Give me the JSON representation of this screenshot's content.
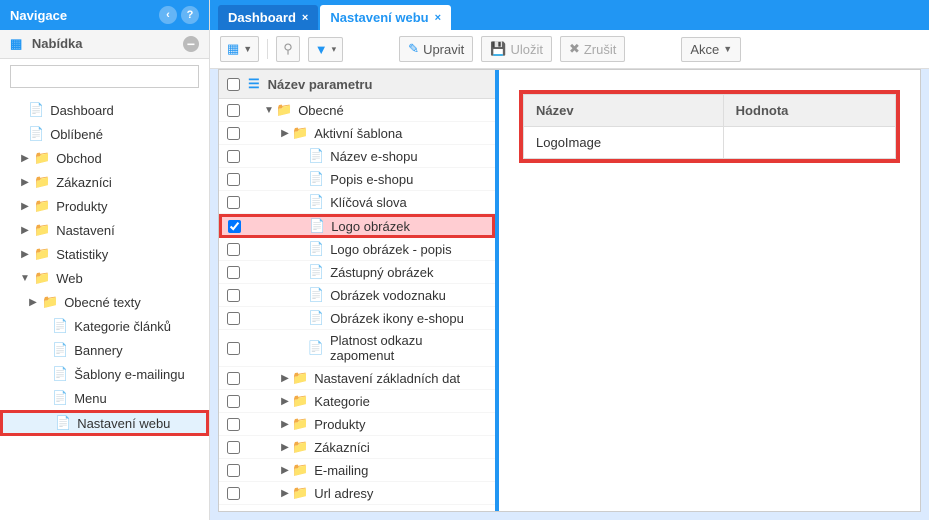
{
  "sidebar": {
    "title": "Navigace",
    "menu_title": "Nabídka",
    "search_placeholder": "",
    "items": [
      {
        "label": "Dashboard",
        "type": "file",
        "level": 1
      },
      {
        "label": "Oblíbené",
        "type": "file",
        "level": 1
      },
      {
        "label": "Obchod",
        "type": "folder",
        "level": 0,
        "caret": "▶"
      },
      {
        "label": "Zákazníci",
        "type": "folder",
        "level": 0,
        "caret": "▶"
      },
      {
        "label": "Produkty",
        "type": "folder",
        "level": 0,
        "caret": "▶"
      },
      {
        "label": "Nastavení",
        "type": "folder",
        "level": 0,
        "caret": "▶"
      },
      {
        "label": "Statistiky",
        "type": "folder",
        "level": 0,
        "caret": "▶"
      },
      {
        "label": "Web",
        "type": "folder",
        "level": 0,
        "caret": "▼"
      },
      {
        "label": "Obecné texty",
        "type": "folder",
        "level": 1,
        "caret": "▶"
      },
      {
        "label": "Kategorie článků",
        "type": "file",
        "level": 2
      },
      {
        "label": "Bannery",
        "type": "file",
        "level": 2
      },
      {
        "label": "Šablony e-mailingu",
        "type": "file",
        "level": 2
      },
      {
        "label": "Menu",
        "type": "file",
        "level": 2
      },
      {
        "label": "Nastavení webu",
        "type": "file",
        "level": 2,
        "selected": true
      }
    ]
  },
  "tabs": [
    {
      "label": "Dashboard",
      "active": false
    },
    {
      "label": "Nastavení webu",
      "active": true
    }
  ],
  "toolbar": {
    "edit": "Upravit",
    "save": "Uložit",
    "cancel": "Zrušit",
    "actions": "Akce"
  },
  "grid": {
    "header": "Název parametru",
    "rows": [
      {
        "label": "Obecné",
        "type": "folder",
        "indent": 1,
        "caret": "▼"
      },
      {
        "label": "Aktivní šablona",
        "type": "folder",
        "indent": 2,
        "caret": "▶"
      },
      {
        "label": "Název e-shopu",
        "type": "file",
        "indent": 3
      },
      {
        "label": "Popis e-shopu",
        "type": "file",
        "indent": 3
      },
      {
        "label": "Klíčová slova",
        "type": "file",
        "indent": 3
      },
      {
        "label": "Logo obrázek",
        "type": "file",
        "indent": 3,
        "selected": true,
        "checked": true
      },
      {
        "label": "Logo obrázek - popis",
        "type": "file",
        "indent": 3
      },
      {
        "label": "Zástupný obrázek",
        "type": "file",
        "indent": 3
      },
      {
        "label": "Obrázek vodoznaku",
        "type": "file",
        "indent": 3
      },
      {
        "label": "Obrázek ikony e-shopu",
        "type": "file",
        "indent": 3
      },
      {
        "label": "Platnost odkazu zapomenut",
        "type": "file",
        "indent": 3
      },
      {
        "label": "Nastavení základních dat",
        "type": "folder",
        "indent": 2,
        "caret": "▶"
      },
      {
        "label": "Kategorie",
        "type": "folder",
        "indent": 2,
        "caret": "▶"
      },
      {
        "label": "Produkty",
        "type": "folder",
        "indent": 2,
        "caret": "▶"
      },
      {
        "label": "Zákazníci",
        "type": "folder",
        "indent": 2,
        "caret": "▶"
      },
      {
        "label": "E-mailing",
        "type": "folder",
        "indent": 2,
        "caret": "▶"
      },
      {
        "label": "Url adresy",
        "type": "folder",
        "indent": 2,
        "caret": "▶"
      }
    ]
  },
  "detail": {
    "headers": {
      "name": "Název",
      "value": "Hodnota"
    },
    "row": {
      "name": "LogoImage",
      "value": ""
    }
  }
}
